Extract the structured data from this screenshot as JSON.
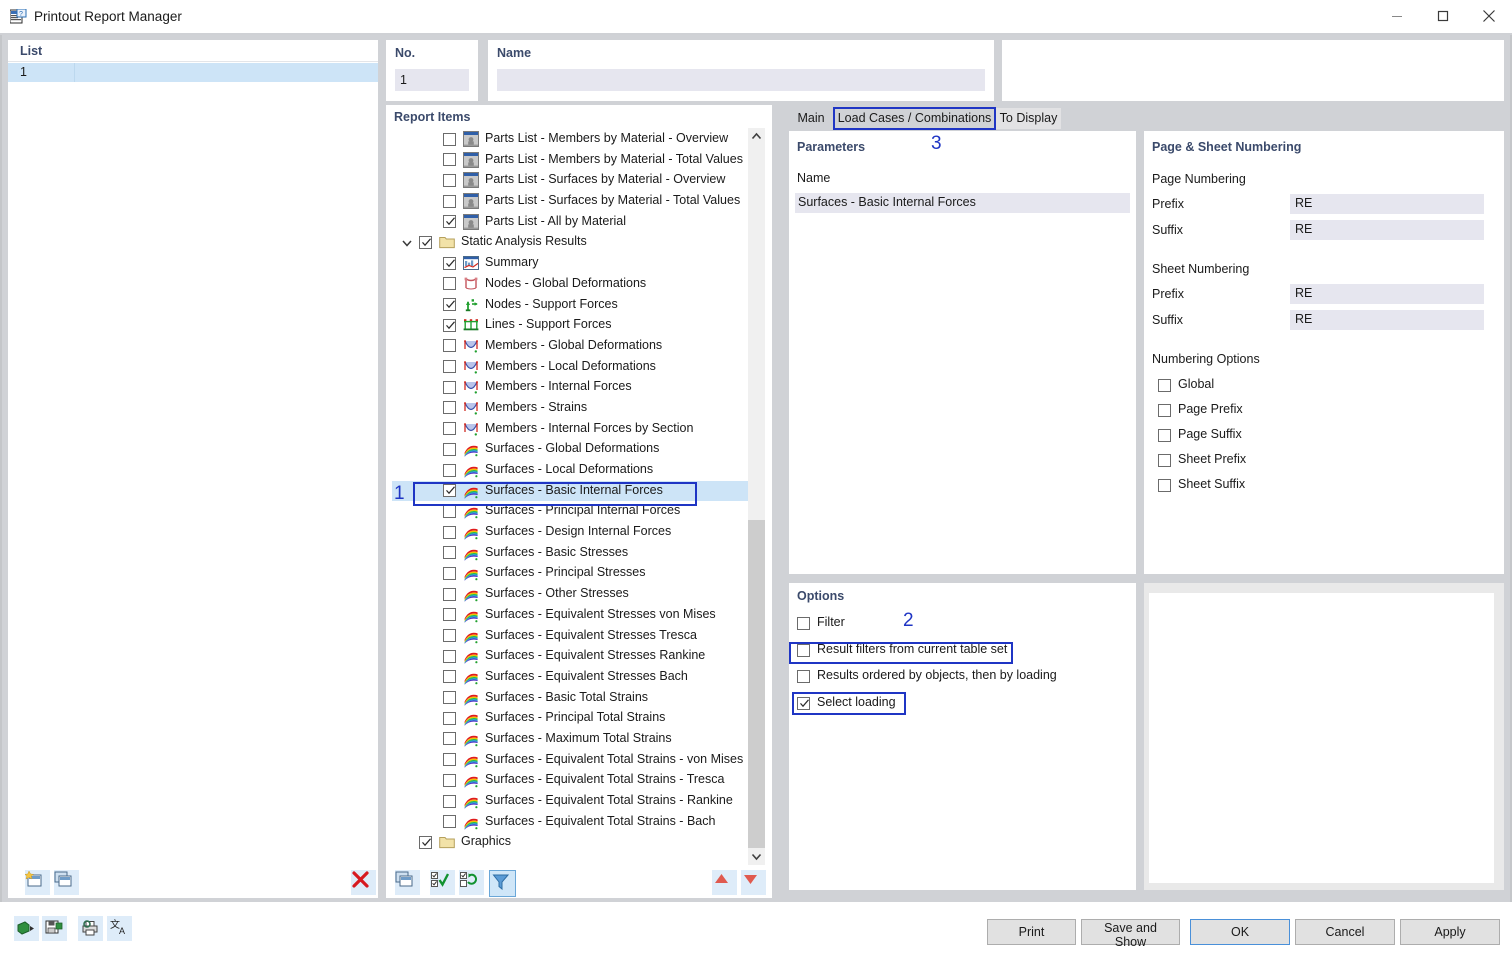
{
  "window": {
    "title": "Printout Report Manager",
    "icon": "report-manager-icon",
    "minimize": "minimize-icon",
    "maximize": "maximize-icon",
    "close": "close-icon"
  },
  "list_panel": {
    "header": "List",
    "rows": [
      {
        "no": "1",
        "name": ""
      }
    ],
    "toolbar": [
      {
        "name": "new-report-icon",
        "title": "New"
      },
      {
        "name": "copy-report-icon",
        "title": "Copy"
      },
      {
        "name": "delete-report-icon",
        "title": "Delete"
      }
    ]
  },
  "no_field": {
    "label": "No.",
    "value": "1"
  },
  "name_field": {
    "label": "Name",
    "value": "",
    "placeholder": ""
  },
  "report_items": {
    "title": "Report Items",
    "items": [
      {
        "label": "Parts List - Members by Material - Overview",
        "checked": false,
        "level": 2,
        "icon": "parts-list-icon"
      },
      {
        "label": "Parts List - Members by Material - Total Values",
        "checked": false,
        "level": 2,
        "icon": "parts-list-icon"
      },
      {
        "label": "Parts List - Surfaces by Material - Overview",
        "checked": false,
        "level": 2,
        "icon": "parts-list-icon"
      },
      {
        "label": "Parts List - Surfaces by Material - Total Values",
        "checked": false,
        "level": 2,
        "icon": "parts-list-icon"
      },
      {
        "label": "Parts List - All by Material",
        "checked": true,
        "level": 2,
        "icon": "parts-list-icon"
      },
      {
        "label": "Static Analysis Results",
        "checked": true,
        "level": 1,
        "icon": "folder-icon",
        "expanded": true
      },
      {
        "label": "Summary",
        "checked": true,
        "level": 2,
        "icon": "summary-chart-icon"
      },
      {
        "label": "Nodes - Global Deformations",
        "checked": false,
        "level": 2,
        "icon": "nodes-deformation-icon"
      },
      {
        "label": "Nodes - Support Forces",
        "checked": true,
        "level": 2,
        "icon": "nodes-support-icon"
      },
      {
        "label": "Lines - Support Forces",
        "checked": true,
        "level": 2,
        "icon": "lines-support-icon"
      },
      {
        "label": "Members - Global Deformations",
        "checked": false,
        "level": 2,
        "icon": "member-curve-icon"
      },
      {
        "label": "Members - Local Deformations",
        "checked": false,
        "level": 2,
        "icon": "member-curve-icon"
      },
      {
        "label": "Members - Internal Forces",
        "checked": false,
        "level": 2,
        "icon": "member-curve-icon"
      },
      {
        "label": "Members - Strains",
        "checked": false,
        "level": 2,
        "icon": "member-curve-icon"
      },
      {
        "label": "Members - Internal Forces by Section",
        "checked": false,
        "level": 2,
        "icon": "member-curve-icon"
      },
      {
        "label": "Surfaces - Global Deformations",
        "checked": false,
        "level": 2,
        "icon": "surface-contour-icon"
      },
      {
        "label": "Surfaces - Local Deformations",
        "checked": false,
        "level": 2,
        "icon": "surface-contour-icon"
      },
      {
        "label": "Surfaces - Basic Internal Forces",
        "checked": true,
        "level": 2,
        "icon": "surface-contour-icon",
        "selected": true,
        "highlight": 1
      },
      {
        "label": "Surfaces - Principal Internal Forces",
        "checked": false,
        "level": 2,
        "icon": "surface-contour-icon"
      },
      {
        "label": "Surfaces - Design Internal Forces",
        "checked": false,
        "level": 2,
        "icon": "surface-contour-icon"
      },
      {
        "label": "Surfaces - Basic Stresses",
        "checked": false,
        "level": 2,
        "icon": "surface-contour-icon"
      },
      {
        "label": "Surfaces - Principal Stresses",
        "checked": false,
        "level": 2,
        "icon": "surface-contour-icon"
      },
      {
        "label": "Surfaces - Other Stresses",
        "checked": false,
        "level": 2,
        "icon": "surface-contour-icon"
      },
      {
        "label": "Surfaces - Equivalent Stresses von Mises",
        "checked": false,
        "level": 2,
        "icon": "surface-contour-icon"
      },
      {
        "label": "Surfaces - Equivalent Stresses Tresca",
        "checked": false,
        "level": 2,
        "icon": "surface-contour-icon"
      },
      {
        "label": "Surfaces - Equivalent Stresses Rankine",
        "checked": false,
        "level": 2,
        "icon": "surface-contour-icon"
      },
      {
        "label": "Surfaces - Equivalent Stresses Bach",
        "checked": false,
        "level": 2,
        "icon": "surface-contour-icon"
      },
      {
        "label": "Surfaces - Basic Total Strains",
        "checked": false,
        "level": 2,
        "icon": "surface-contour-icon"
      },
      {
        "label": "Surfaces - Principal Total Strains",
        "checked": false,
        "level": 2,
        "icon": "surface-contour-icon"
      },
      {
        "label": "Surfaces - Maximum Total Strains",
        "checked": false,
        "level": 2,
        "icon": "surface-contour-icon"
      },
      {
        "label": "Surfaces - Equivalent Total Strains - von Mises",
        "checked": false,
        "level": 2,
        "icon": "surface-contour-icon"
      },
      {
        "label": "Surfaces - Equivalent Total Strains - Tresca",
        "checked": false,
        "level": 2,
        "icon": "surface-contour-icon"
      },
      {
        "label": "Surfaces - Equivalent Total Strains - Rankine",
        "checked": false,
        "level": 2,
        "icon": "surface-contour-icon"
      },
      {
        "label": "Surfaces - Equivalent Total Strains - Bach",
        "checked": false,
        "level": 2,
        "icon": "surface-contour-icon"
      },
      {
        "label": "Graphics",
        "checked": true,
        "level": 1,
        "icon": "folder-icon"
      }
    ],
    "toolbar": [
      {
        "name": "copy-item-icon"
      },
      {
        "name": "select-all-icon"
      },
      {
        "name": "invert-selection-icon"
      },
      {
        "name": "filter-icon",
        "active": true
      },
      {
        "name": "move-up-icon"
      },
      {
        "name": "move-down-icon"
      }
    ],
    "scrollbar": {
      "up": "chevron-up-icon",
      "down": "chevron-down-icon"
    }
  },
  "tabs": [
    {
      "label": "Main",
      "active": false
    },
    {
      "label": "Load Cases / Combinations",
      "active": true,
      "highlight": 3
    },
    {
      "label": "To Display",
      "active": false
    }
  ],
  "parameters": {
    "title": "Parameters",
    "column": "Name",
    "rows": [
      "Surfaces - Basic Internal Forces"
    ]
  },
  "options": {
    "title": "Options",
    "items": [
      {
        "label": "Filter",
        "checked": false
      },
      {
        "label": "Result filters from current table set",
        "checked": false,
        "highlight": 2
      },
      {
        "label": "Results ordered by objects, then by loading",
        "checked": false
      },
      {
        "label": "Select loading",
        "checked": true,
        "highlighted": true
      }
    ]
  },
  "page_sheet_numbering": {
    "title": "Page & Sheet Numbering",
    "page_numbering": {
      "heading": "Page Numbering",
      "prefix": {
        "label": "Prefix",
        "value": "RE"
      },
      "suffix": {
        "label": "Suffix",
        "value": "RE"
      }
    },
    "sheet_numbering": {
      "heading": "Sheet Numbering",
      "prefix": {
        "label": "Prefix",
        "value": "RE"
      },
      "suffix": {
        "label": "Suffix",
        "value": "RE"
      }
    },
    "numbering_options": {
      "heading": "Numbering Options",
      "items": [
        {
          "label": "Global",
          "checked": false
        },
        {
          "label": "Page Prefix",
          "checked": false
        },
        {
          "label": "Page Suffix",
          "checked": false
        },
        {
          "label": "Sheet Prefix",
          "checked": false
        },
        {
          "label": "Sheet Suffix",
          "checked": false
        }
      ]
    }
  },
  "bottom_toolbar": [
    {
      "name": "export-icon"
    },
    {
      "name": "save-report-icon"
    },
    {
      "name": "printer-settings-icon"
    },
    {
      "name": "language-icon"
    }
  ],
  "buttons": {
    "print": "Print",
    "save_and_show": "Save and Show",
    "ok": "OK",
    "cancel": "Cancel",
    "apply": "Apply"
  },
  "annotations": [
    {
      "number": "1"
    },
    {
      "number": "2"
    },
    {
      "number": "3"
    }
  ],
  "colors": {
    "accent_blue": "#1f35c4",
    "selection_blue": "#cde4f7",
    "field_bg": "#e6e6ef",
    "header_text": "#3b4a6b",
    "window_bg": "#d0d2d6"
  }
}
